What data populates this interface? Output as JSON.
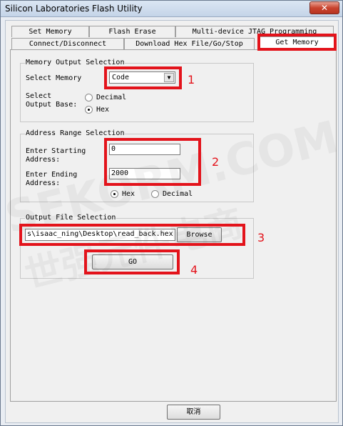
{
  "window": {
    "title": "Silicon Laboratories Flash Utility",
    "close_glyph": "✕"
  },
  "tabs": {
    "row1": [
      "Set Memory",
      "Flash Erase",
      "Multi-device JTAG Programming"
    ],
    "row2": [
      "Connect/Disconnect",
      "Download Hex File/Go/Stop",
      "Get Memory"
    ],
    "active": "Get Memory"
  },
  "memory_output": {
    "title": "Memory Output Selection",
    "select_label": "Select\nMemory",
    "select_value": "Code",
    "base_label": "Select\nOutput Base:",
    "radio_decimal": "Decimal",
    "radio_hex": "Hex",
    "base_selected": "Hex"
  },
  "address_range": {
    "title": "Address Range Selection",
    "start_label": "Enter Starting\nAddress:",
    "start_value": "0",
    "end_label": "Enter Ending\nAddress:",
    "end_value": "2000",
    "radio_hex": "Hex",
    "radio_decimal": "Decimal",
    "base_selected": "Hex"
  },
  "output_file": {
    "title": "Output File Selection",
    "path_value": "s\\isaac_ning\\Desktop\\read_back.hex",
    "browse_label": "Browse",
    "go_label": "GO"
  },
  "footer": {
    "cancel_label": "取消"
  },
  "annotations": {
    "labels": [
      "1",
      "2",
      "3",
      "4"
    ],
    "color": "#e3131b"
  },
  "watermark": {
    "line1": "SEKORM.COM",
    "line2": "世强元件电商"
  }
}
